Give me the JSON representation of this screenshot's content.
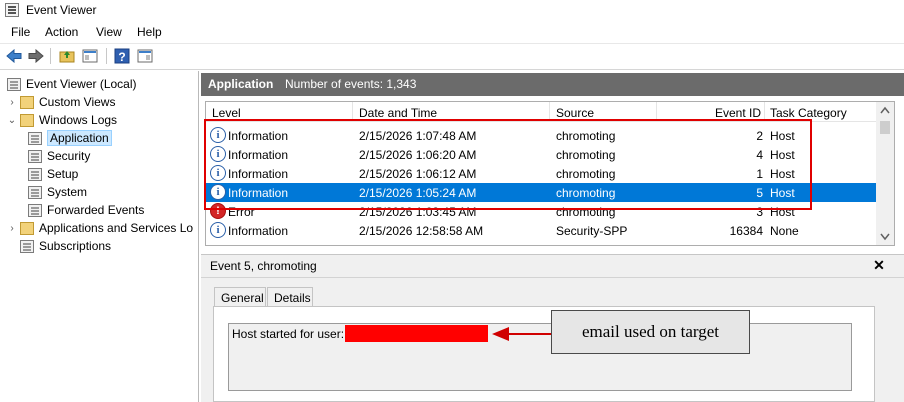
{
  "window": {
    "title": "Event Viewer"
  },
  "menu": [
    "File",
    "Action",
    "View",
    "Help"
  ],
  "toolbar": {
    "icons": [
      "back-arrow-icon",
      "forward-arrow-icon",
      "up-folder-icon",
      "show-hide-tree-icon",
      "help-icon",
      "properties-icon"
    ]
  },
  "tree": {
    "root": "Event Viewer (Local)",
    "custom_views": "Custom Views",
    "windows_logs": "Windows Logs",
    "application": "Application",
    "security": "Security",
    "setup": "Setup",
    "system": "System",
    "forwarded": "Forwarded Events",
    "apps_services": "Applications and Services Lo",
    "subscriptions": "Subscriptions"
  },
  "log_header": {
    "title": "Application",
    "count": "Number of events: 1,343"
  },
  "columns": {
    "level": "Level",
    "datetime": "Date and Time",
    "source": "Source",
    "event_id": "Event ID",
    "task": "Task Category"
  },
  "events": [
    {
      "level": "Information",
      "datetime": "2/15/2026 1:07:48 AM",
      "source": "chromoting",
      "event_id": "2",
      "task": "Host"
    },
    {
      "level": "Information",
      "datetime": "2/15/2026 1:06:20 AM",
      "source": "chromoting",
      "event_id": "4",
      "task": "Host"
    },
    {
      "level": "Information",
      "datetime": "2/15/2026 1:06:12 AM",
      "source": "chromoting",
      "event_id": "1",
      "task": "Host"
    },
    {
      "level": "Information",
      "datetime": "2/15/2026 1:05:24 AM",
      "source": "chromoting",
      "event_id": "5",
      "task": "Host"
    },
    {
      "level": "Error",
      "datetime": "2/15/2026 1:03:45 AM",
      "source": "chromoting",
      "event_id": "3",
      "task": "Host"
    },
    {
      "level": "Information",
      "datetime": "2/15/2026 12:58:58 AM",
      "source": "Security-SPP",
      "event_id": "16384",
      "task": "None"
    }
  ],
  "details": {
    "title": "Event 5, chromoting",
    "tabs": [
      "General",
      "Details"
    ],
    "message": "Host started for user:",
    "annotation": "email used on target"
  },
  "colors": {
    "header_bar": "#6b6b6b",
    "selection": "#0078d7",
    "annotation_red": "#e00000"
  }
}
